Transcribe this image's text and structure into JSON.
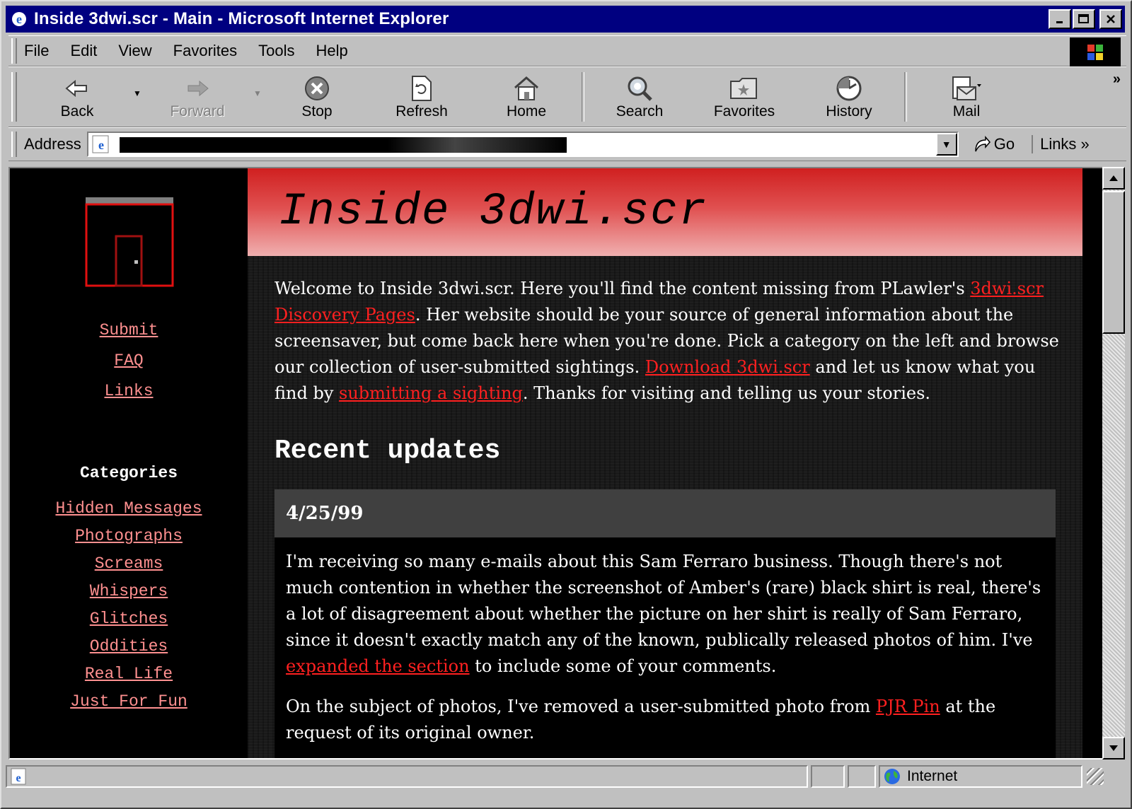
{
  "window": {
    "title": "Inside 3dwi.scr - Main - Microsoft Internet Explorer",
    "minimize_label": "_",
    "maximize_label": "□",
    "close_label": "✕"
  },
  "menu": {
    "items": [
      {
        "label": "File"
      },
      {
        "label": "Edit"
      },
      {
        "label": "View"
      },
      {
        "label": "Favorites"
      },
      {
        "label": "Tools"
      },
      {
        "label": "Help"
      }
    ]
  },
  "toolbar": {
    "back": "Back",
    "forward": "Forward",
    "stop": "Stop",
    "refresh": "Refresh",
    "home": "Home",
    "search": "Search",
    "favorites": "Favorites",
    "history": "History",
    "mail": "Mail"
  },
  "address": {
    "label": "Address",
    "url": "",
    "go_label": "Go",
    "links_label": "Links"
  },
  "page": {
    "banner_title": "Inside 3dwi.scr",
    "nav_links": [
      {
        "label": "Submit"
      },
      {
        "label": "FAQ"
      },
      {
        "label": "Links"
      }
    ],
    "categories_title": "Categories",
    "categories": [
      {
        "label": "Hidden Messages"
      },
      {
        "label": "Photographs"
      },
      {
        "label": "Screams"
      },
      {
        "label": "Whispers"
      },
      {
        "label": "Glitches"
      },
      {
        "label": "Oddities"
      },
      {
        "label": "Real Life"
      },
      {
        "label": "Just For Fun"
      }
    ],
    "intro": {
      "t1": "Welcome to Inside 3dwi.scr. Here you'll find the content missing from PLawler's ",
      "link1": "3dwi.scr Discovery Pages",
      "t2": ". Her website should be your source of general information about the screensaver, but come back here when you're done. Pick a category on the left and browse our collection of user-submitted sightings. ",
      "link2": "Download 3dwi.scr",
      "t3": " and let us know what you find by ",
      "link3": "submitting a sighting",
      "t4": ". Thanks for visiting and telling us your stories."
    },
    "updates_heading": "Recent updates",
    "post": {
      "date": "4/25/99",
      "p1_text": "I'm receiving so many e-mails about this Sam Ferraro business. Though there's not much contention in whether the screenshot of Amber's (rare) black shirt is real, there's a lot of disagreement about whether the picture on her shirt is really of Sam Ferraro, since it doesn't exactly match any of the known, publically released photos of him. I've ",
      "p1_link": "expanded the section",
      "p1_end": " to include some of your comments.",
      "p2_text": "On the subject of photos, I've removed a user-submitted photo from ",
      "p2_link": "PJR Pin",
      "p2_end": " at the request of its original owner."
    }
  },
  "status": {
    "zone": "Internet"
  },
  "colors": {
    "titlebar": "#000080",
    "link": "#ff2020",
    "nav_link": "#ff9090",
    "banner_top": "#d02020"
  }
}
